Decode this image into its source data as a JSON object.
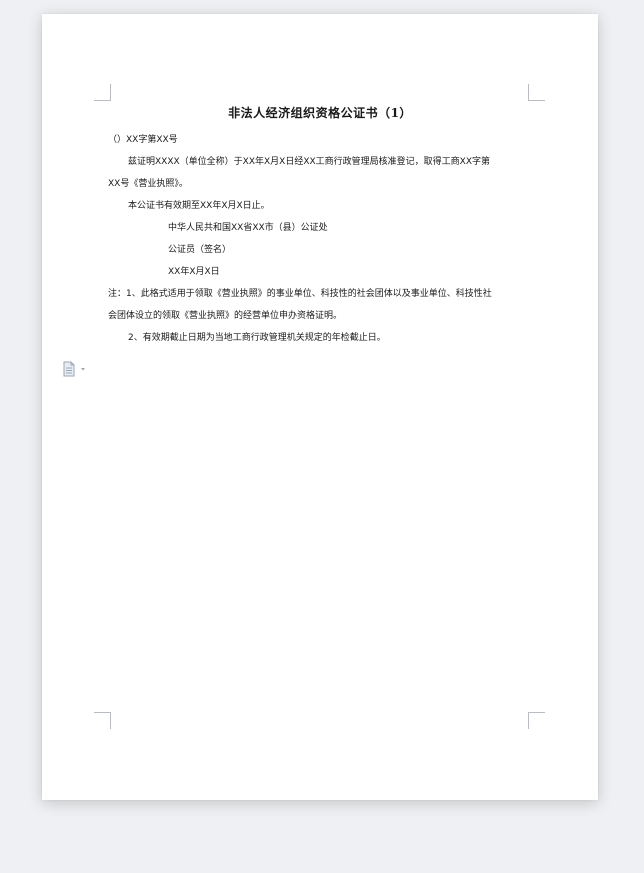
{
  "document": {
    "title": "非法人经济组织资格公证书（1）",
    "ref_line": "（）XX字第XX号",
    "para1_line1": "兹证明XXXX（单位全称）于XX年X月X日经XX工商行政管理局核准登记，取得工商XX字第",
    "para1_line2": "XX号《营业执照》。",
    "para2": "本公证书有效期至XX年X月X日止。",
    "office": "中华人民共和国XX省XX市（县）公证处",
    "notary": "公证员（签名）",
    "date": "XX年X月X日",
    "note1_line1": "注：1、此格式适用于领取《营业执照》的事业单位、科技性的社会团体以及事业单位、科技性社",
    "note1_line2": "会团体设立的领取《营业执照》的经营单位申办资格证明。",
    "note2": "2、有效期截止日期为当地工商行政管理机关规定的年检截止日。"
  },
  "icons": {
    "paste_options": "document-icon"
  }
}
